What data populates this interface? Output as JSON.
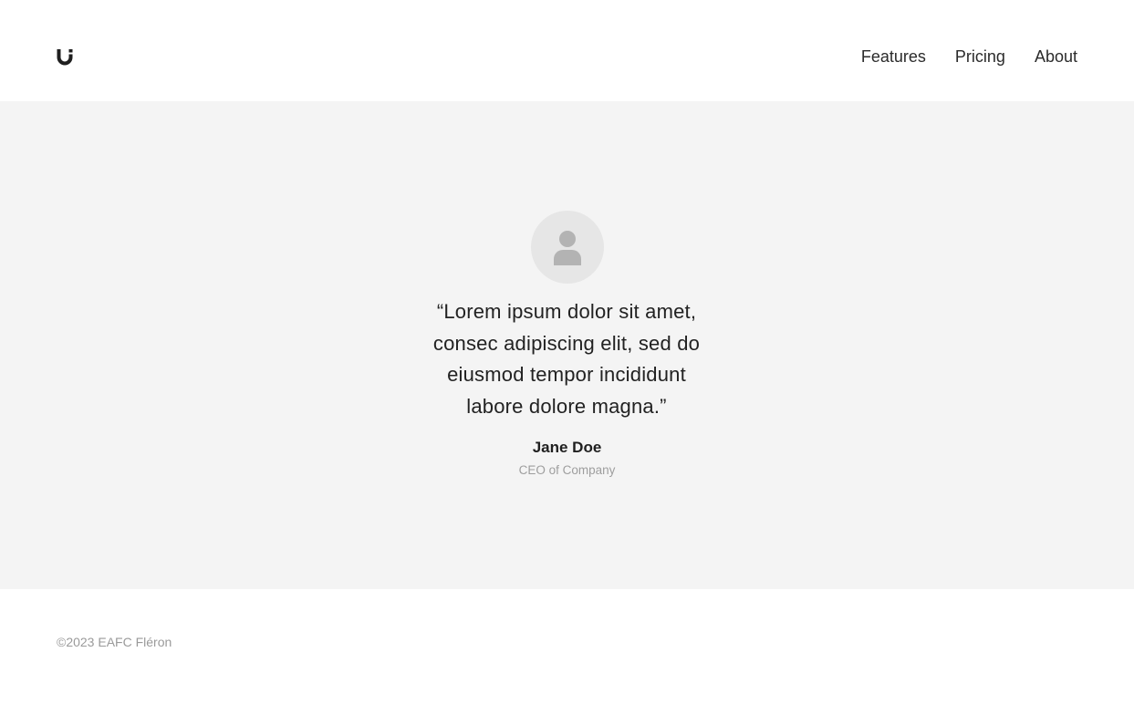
{
  "header": {
    "logo_icon": "magnet-u-icon",
    "nav": {
      "features": "Features",
      "pricing": "Pricing",
      "about": "About"
    }
  },
  "testimonial": {
    "avatar_icon": "person-icon",
    "quote_lines": [
      "“Lorem ipsum dolor sit amet,",
      "consec adipiscing elit, sed do",
      "eiusmod tempor incididunt",
      "labore dolore magna.”"
    ],
    "name": "Jane Doe",
    "role": "CEO of Company"
  },
  "footer": {
    "copyright": "©2023 EAFC Fléron"
  },
  "colors": {
    "hero_background": "#f4f4f4",
    "text_primary": "#1f1f1f",
    "text_muted": "#9e9e9e",
    "avatar_background": "#e6e6e6",
    "avatar_glyph": "#b3b3b3"
  }
}
